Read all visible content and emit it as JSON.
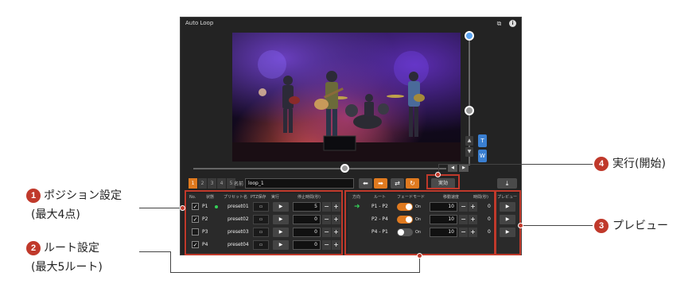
{
  "window": {
    "title": "Auto Loop",
    "header_icons": [
      "layers-icon",
      "info-icon"
    ]
  },
  "controls": {
    "zoom_tele": "T",
    "zoom_wide": "W"
  },
  "toolbar": {
    "loop_tabs": [
      "1",
      "2",
      "3",
      "4",
      "5"
    ],
    "active_tab": "1",
    "name_label": "名前",
    "name_value": "loop_1",
    "execute_label": "実効"
  },
  "positions": {
    "headers": [
      "No.",
      "状態",
      "プリセット名",
      "PTZ保存",
      "実行",
      "停止時間(秒)"
    ],
    "rows": [
      {
        "checked": true,
        "no": "P1",
        "status_dot": true,
        "preset": "preset01",
        "stop": "5"
      },
      {
        "checked": true,
        "no": "P2",
        "status_dot": false,
        "preset": "preset02",
        "stop": "0"
      },
      {
        "checked": false,
        "no": "P3",
        "status_dot": false,
        "preset": "preset03",
        "stop": "0"
      },
      {
        "checked": true,
        "no": "P4",
        "status_dot": false,
        "preset": "preset04",
        "stop": "0"
      }
    ]
  },
  "routes": {
    "headers": [
      "方向",
      "ルート",
      "フェードモード",
      "移動速度",
      "時間(秒)"
    ],
    "rows": [
      {
        "arrow": true,
        "route": "P1 - P2",
        "fade_on": true,
        "fade_label": "On",
        "speed": "10",
        "time": "0"
      },
      {
        "arrow": false,
        "route": "P2 - P4",
        "fade_on": true,
        "fade_label": "On",
        "speed": "10",
        "time": "0"
      },
      {
        "arrow": false,
        "route": "P4 - P1",
        "fade_on": false,
        "fade_label": "On",
        "speed": "10",
        "time": "0"
      }
    ]
  },
  "preview": {
    "header": "プレビュー"
  },
  "annotations": {
    "a1": {
      "num": "1",
      "line1": "ポジション設定",
      "line2": "(最大4点)"
    },
    "a2": {
      "num": "2",
      "line1": "ルート設定",
      "line2": "(最大5ルート)"
    },
    "a3": {
      "num": "3",
      "text": "プレビュー"
    },
    "a4": {
      "num": "4",
      "text": "実行(開始)"
    }
  },
  "colors": {
    "accent": "#e07a1f",
    "highlight": "#c0392b",
    "status_green": "#34d058",
    "zoom_blue": "#3a7fd1"
  }
}
